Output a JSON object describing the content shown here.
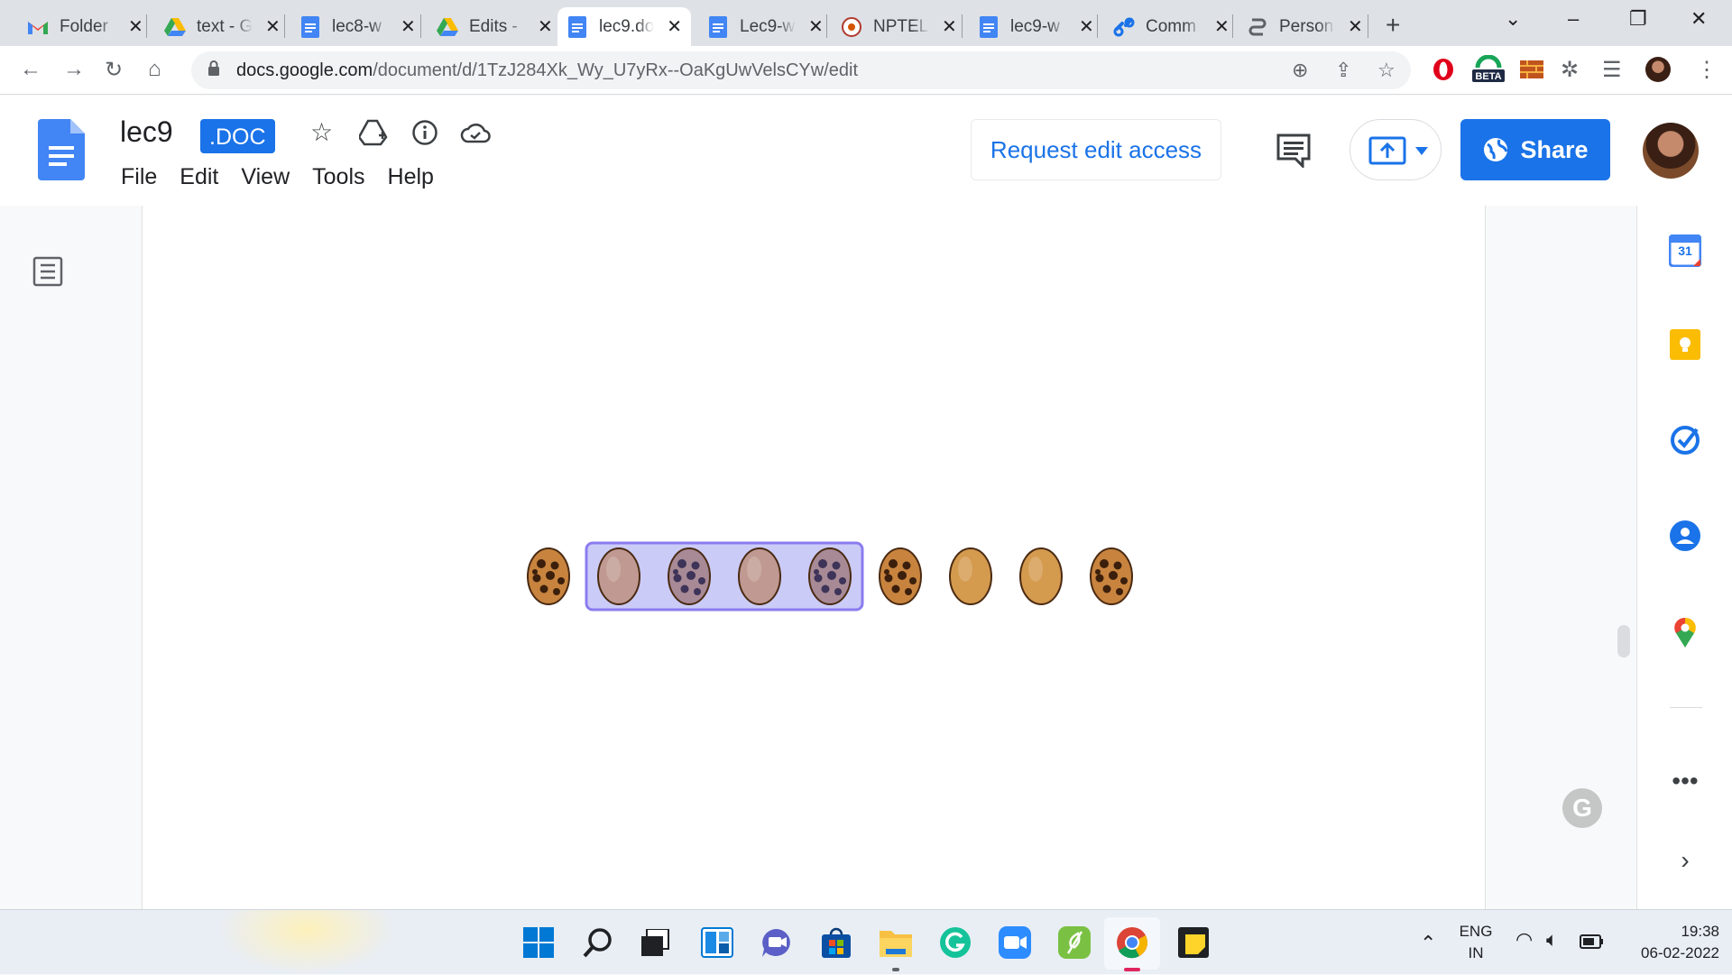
{
  "browser": {
    "tabs": [
      {
        "title": "Folder",
        "icon": "gmail-icon"
      },
      {
        "title": "text - G",
        "icon": "drive-icon"
      },
      {
        "title": "lec8-w",
        "icon": "docs-icon"
      },
      {
        "title": "Edits -",
        "icon": "drive-icon"
      },
      {
        "title": "lec9.do",
        "icon": "docs-icon",
        "active": true
      },
      {
        "title": "Lec9-w",
        "icon": "docs-icon"
      },
      {
        "title": "NPTEL",
        "icon": "nptel-icon"
      },
      {
        "title": "lec9-w",
        "icon": "docs-icon"
      },
      {
        "title": "Comm",
        "icon": "link-icon"
      },
      {
        "title": "Person",
        "icon": "chain-icon"
      }
    ],
    "url_host": "docs.google.com",
    "url_path": "/document/d/1TzJ284Xk_Wy_U7yRx--OaKgUwVelsCYw/edit",
    "beta_badge": "BETA"
  },
  "doc": {
    "title": "lec9",
    "badge": ".DOC",
    "menu": [
      "File",
      "Edit",
      "View",
      "Tools",
      "Help"
    ],
    "request_edit": "Request edit access",
    "share": "Share"
  },
  "cookies": {
    "items": [
      "cookie",
      "egg",
      "cookie",
      "egg",
      "cookie",
      "cookie",
      "egg",
      "egg",
      "cookie"
    ],
    "selected_range": [
      1,
      4
    ],
    "colors": {
      "cookie": "#c8843e",
      "egg_plain": "#d49a4e",
      "egg_selected": "#c09a92",
      "selection": "#8b7cf0"
    }
  },
  "sidepanel": {
    "calendar_day": "31",
    "icons": [
      "calendar-icon",
      "keep-icon",
      "tasks-icon",
      "contacts-icon",
      "maps-icon",
      "more-icon",
      "expand-icon"
    ]
  },
  "taskbar": {
    "lang_top": "ENG",
    "lang_bottom": "IN",
    "time": "19:38",
    "date": "06-02-2022",
    "grammarly": "G"
  }
}
